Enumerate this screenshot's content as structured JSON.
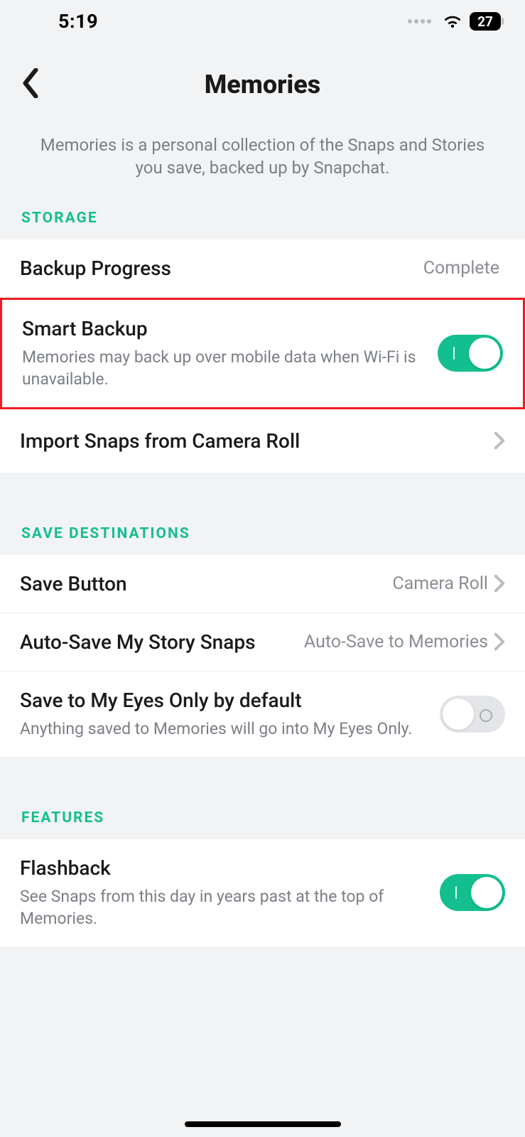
{
  "statusBar": {
    "time": "5:19",
    "battery": "27"
  },
  "header": {
    "title": "Memories"
  },
  "description": "Memories is a personal collection of the Snaps and Stories you save, backed up by Snapchat.",
  "sections": {
    "storage": {
      "title": "STORAGE",
      "backupProgress": {
        "label": "Backup Progress",
        "value": "Complete"
      },
      "smartBackup": {
        "label": "Smart Backup",
        "sub": "Memories may back up over mobile data when Wi-Fi is unavailable."
      },
      "importSnaps": {
        "label": "Import Snaps from Camera Roll"
      }
    },
    "saveDestinations": {
      "title": "SAVE DESTINATIONS",
      "saveButton": {
        "label": "Save Button",
        "value": "Camera Roll"
      },
      "autoSave": {
        "label": "Auto-Save My Story Snaps",
        "value": "Auto-Save to Memories"
      },
      "eyesOnly": {
        "label": "Save to My Eyes Only by default",
        "sub": "Anything saved to Memories will go into My Eyes Only."
      }
    },
    "features": {
      "title": "FEATURES",
      "flashback": {
        "label": "Flashback",
        "sub": "See Snaps from this day in years past at the top of Memories."
      }
    }
  }
}
